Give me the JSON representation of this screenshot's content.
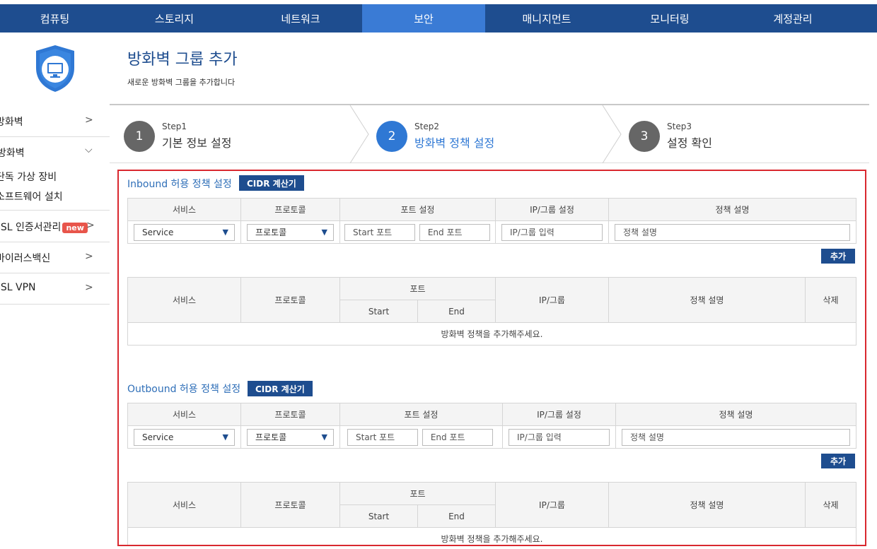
{
  "nav": {
    "items": [
      "컴퓨팅",
      "스토리지",
      "네트워크",
      "보안",
      "매니지먼트",
      "모니터링",
      "계정관리"
    ],
    "active": "보안"
  },
  "sidebar": {
    "firewall": "방화벽",
    "virtual_firewall": "방화벽",
    "sub_dedicated": "단독 가상 장비",
    "sub_software": "소프트웨어 설치",
    "ssl_cert": "SSL 인증서관리",
    "new_badge": "new",
    "antivirus": "바이러스백신",
    "ssl_vpn": "SSL VPN"
  },
  "header": {
    "title": "방화벽 그룹 추가",
    "subtitle": "새로운 방화벽 그룹을 추가합니다"
  },
  "steps": [
    {
      "num": "1",
      "small": "Step1",
      "label": "기본 정보 설정"
    },
    {
      "num": "2",
      "small": "Step2",
      "label": "방화벽 정책 설정"
    },
    {
      "num": "3",
      "small": "Step3",
      "label": "설정 확인"
    }
  ],
  "inbound": {
    "title": "Inbound 허용 정책 설정",
    "cidr": "CIDR 계산기",
    "form_headers": [
      "서비스",
      "프로토콜",
      "포트 설정",
      "IP/그룹 설정",
      "정책 설명"
    ],
    "service_value": "Service",
    "protocol_value": "프로토콜",
    "start_placeholder": "Start 포트",
    "end_placeholder": "End 포트",
    "ip_placeholder": "IP/그룹 입력",
    "desc_placeholder": "정책 설명",
    "add": "추가",
    "list_headers": {
      "service": "서비스",
      "protocol": "프로토콜",
      "port": "포트",
      "start": "Start",
      "end": "End",
      "ip": "IP/그룹",
      "desc": "정책 설명",
      "delete": "삭제"
    },
    "empty": "방화벽 정책을 추가해주세요."
  },
  "outbound": {
    "title": "Outbound 허용 정책 설정",
    "cidr": "CIDR 계산기",
    "form_headers": [
      "서비스",
      "프로토콜",
      "포트 설정",
      "IP/그룹 설정",
      "정책 설명"
    ],
    "service_value": "Service",
    "protocol_value": "프로토콜",
    "start_placeholder": "Start 포트",
    "end_placeholder": "End 포트",
    "ip_placeholder": "IP/그룹 입력",
    "desc_placeholder": "정책 설명",
    "add": "추가",
    "list_headers": {
      "service": "서비스",
      "protocol": "프로토콜",
      "port": "포트",
      "start": "Start",
      "end": "End",
      "ip": "IP/그룹",
      "desc": "정책 설명",
      "delete": "삭제"
    },
    "empty": "방화벽 정책을 추가해주세요."
  },
  "colors": {
    "nav_bg": "#1e4d8f",
    "nav_active": "#3a7bd5",
    "step_active": "#2f78d4",
    "highlight_border": "#d9282f"
  }
}
